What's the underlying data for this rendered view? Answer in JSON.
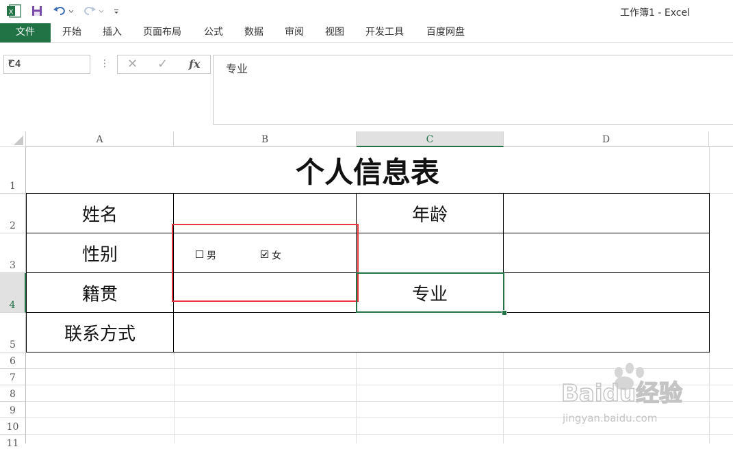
{
  "window": {
    "title": "工作簿1 - Excel"
  },
  "ribbon": {
    "tabs": [
      {
        "label": "文件"
      },
      {
        "label": "开始"
      },
      {
        "label": "插入"
      },
      {
        "label": "页面布局"
      },
      {
        "label": "公式"
      },
      {
        "label": "数据"
      },
      {
        "label": "审阅"
      },
      {
        "label": "视图"
      },
      {
        "label": "开发工具"
      },
      {
        "label": "百度网盘"
      }
    ]
  },
  "formula_bar": {
    "name_box": "C4",
    "fx_label": "fx",
    "content": "专业"
  },
  "columns": [
    "A",
    "B",
    "C",
    "D"
  ],
  "rows": [
    "1",
    "2",
    "3",
    "4",
    "5",
    "6",
    "7",
    "8",
    "9",
    "10",
    "11"
  ],
  "sheet": {
    "title": "个人信息表",
    "labels": {
      "name": "姓名",
      "age": "年龄",
      "gender": "性别",
      "native_place": "籍贯",
      "major": "专业",
      "contact": "联系方式"
    },
    "checkboxes": [
      {
        "label": "男",
        "checked": false
      },
      {
        "label": "女",
        "checked": true
      }
    ]
  },
  "active_cell": {
    "column": "C",
    "row": "4"
  },
  "watermark": {
    "brand": "Baidu经验",
    "url": "jingyan.baidu.com"
  },
  "colors": {
    "accent": "#217346",
    "highlight": "#e8353b"
  }
}
